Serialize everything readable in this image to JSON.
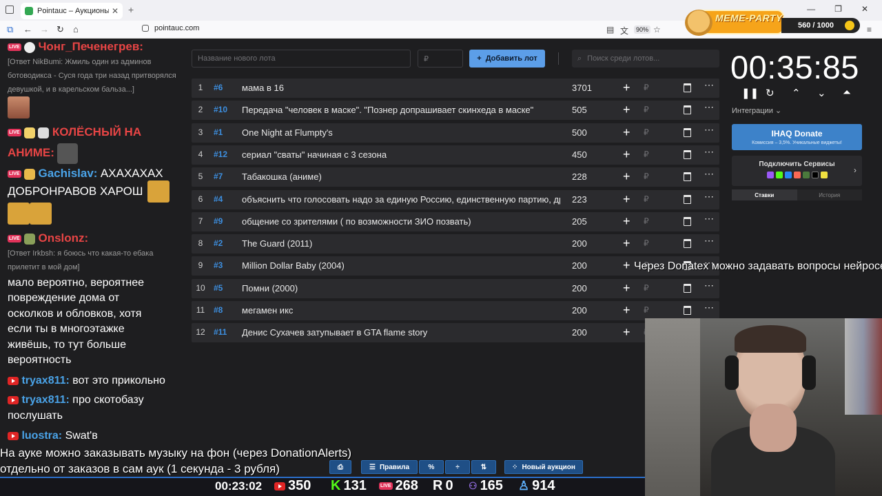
{
  "browser": {
    "tab_title": "Pointauc – Аукционы, лотереи",
    "url": "pointauc.com",
    "zoom": "90%"
  },
  "meme_party": {
    "title": "MEME-PARTY",
    "score": "560 / 1000"
  },
  "chat": {
    "messages": [
      {
        "nick": "Чонг_Печенегрев:",
        "nick_color": "#e84545"
      },
      {
        "reply": "[Ответ NikBumi: Жмиль один из админов"
      },
      {
        "reply": "ботоводикса - Суся года три назад притворялся"
      },
      {
        "reply": "девушкой, и в карельском бальза...]"
      },
      {
        "nick": "КОЛЁСНЫЙ НА",
        "nick_color": "#e84545"
      },
      {
        "nick": "АНИМЕ:",
        "nick_color": "#e84545"
      },
      {
        "nick": "Gachislav:",
        "nick_color": "#4aa3e8",
        "text": "АХАХАХАХ"
      },
      {
        "text": "ДОБРОНРАВОВ ХАРОШ"
      },
      {
        "nick": "Onslonz:",
        "nick_color": "#e84545"
      },
      {
        "reply": "[Ответ Irkbsh: я боюсь что какая-то ебака"
      },
      {
        "reply": "прилетит в мой дом]"
      },
      {
        "text": "мало вероятно, вероятнее"
      },
      {
        "text": "повреждение дома от"
      },
      {
        "text": "осколков и обловков, хотя"
      },
      {
        "text": "если ты в многоэтажке"
      },
      {
        "text": "живёшь, то тут больше"
      },
      {
        "text": "вероятность"
      },
      {
        "nick": "tryax811:",
        "nick_color": "#4aa3e8",
        "text": "вот это прикольно"
      },
      {
        "nick": "tryax811:",
        "nick_color": "#4aa3e8",
        "text": "про скотобазу"
      },
      {
        "text": "послушать"
      },
      {
        "nick": "luostra:",
        "nick_color": "#4aa3e8",
        "text": "Swat'в"
      }
    ]
  },
  "auction": {
    "new_lot_placeholder": "Название нового лота",
    "amount_placeholder": "₽",
    "add_label": "Добавить лот",
    "search_placeholder": "Поиск среди лотов...",
    "lots": [
      {
        "n": "1",
        "id": "#6",
        "name": "мама в 16",
        "amount": "3701"
      },
      {
        "n": "2",
        "id": "#10",
        "name": "Передача \"человек в маске\". \"Познер допрашивает скинхеда в маске\"",
        "amount": "505"
      },
      {
        "n": "3",
        "id": "#1",
        "name": "One Night at Flumpty's",
        "amount": "500"
      },
      {
        "n": "4",
        "id": "#12",
        "name": "сериал \"сваты\" начиная с 3 сезона",
        "amount": "450"
      },
      {
        "n": "5",
        "id": "#7",
        "name": "Табакошка (аниме)",
        "amount": "228"
      },
      {
        "n": "6",
        "id": "#4",
        "name": "объяснить что голосовать надо за единую Россию, единственную партию, дру",
        "amount": "223"
      },
      {
        "n": "7",
        "id": "#9",
        "name": "общение со зрителями ( по возможности ЗИО позвать)",
        "amount": "205"
      },
      {
        "n": "8",
        "id": "#2",
        "name": "The Guard (2011)",
        "amount": "200"
      },
      {
        "n": "9",
        "id": "#3",
        "name": "Million Dollar Baby (2004)",
        "amount": "200"
      },
      {
        "n": "10",
        "id": "#5",
        "name": "Помни (2000)",
        "amount": "200"
      },
      {
        "n": "11",
        "id": "#8",
        "name": "мегамен икс",
        "amount": "200"
      },
      {
        "n": "12",
        "id": "#11",
        "name": "Денис Сухачев затупывает в GTA flame story",
        "amount": "200"
      }
    ],
    "currency": "₽"
  },
  "panel": {
    "timer": "00:35:85",
    "integrations_label": "Интеграции",
    "donate_title": "IHAQ Donate",
    "donate_sub": "Комиссия – 3,5%. Уникальные виджеты!",
    "services_label": "Подключить Сервисы",
    "tab_bets": "Ставки",
    "tab_history": "История"
  },
  "overlay": {
    "donatex_caption": "Через Donatex можно задавать вопросы нейросети",
    "music_line1": "На ауке можно заказывать музыку на фон (через DonationAlerts)",
    "music_line2": "отдельно от заказов в сам аук (1 секунда - 3 рубля)",
    "rules_label": "Правила",
    "new_auction_label": "Новый аукцион"
  },
  "stats": {
    "stream_time": "00:23:02",
    "youtube": "350",
    "kick": "131",
    "vk_live": "268",
    "rutube": "0",
    "trovo": "165",
    "total": "914"
  }
}
